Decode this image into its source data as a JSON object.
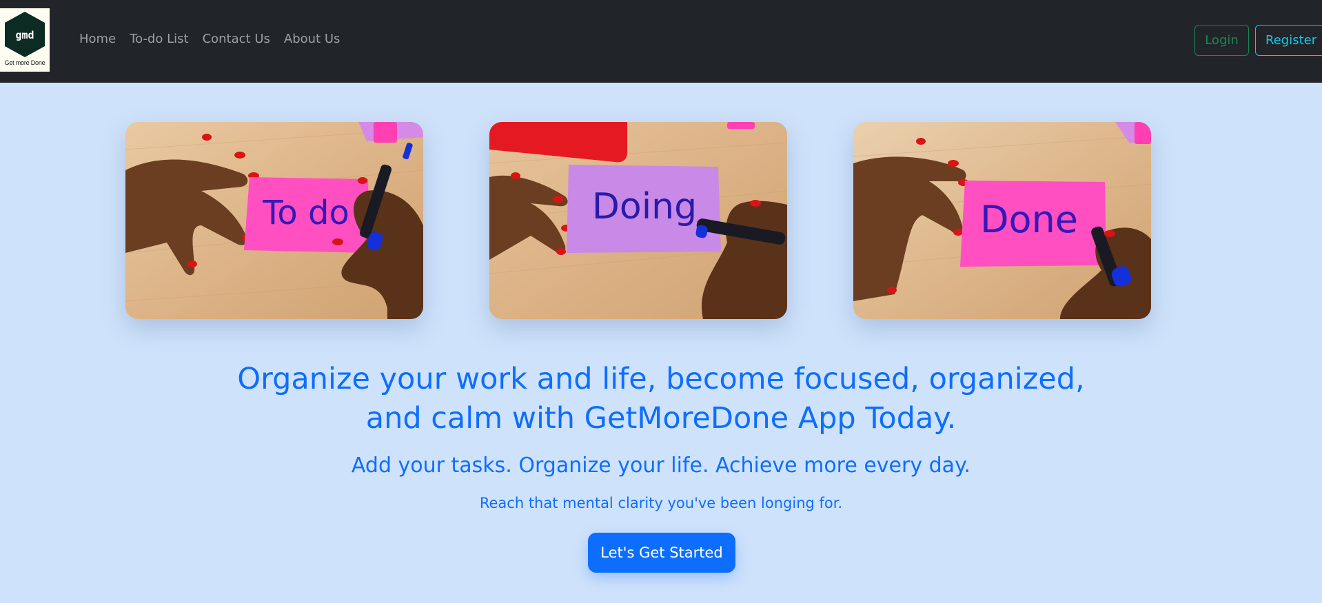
{
  "navbar": {
    "logo_text": "gmd",
    "logo_tagline": "Get more Done",
    "links": [
      {
        "label": "Home"
      },
      {
        "label": "To-do List"
      },
      {
        "label": "Contact Us"
      },
      {
        "label": "About Us"
      }
    ],
    "login_label": "Login",
    "register_label": "Register"
  },
  "cards": [
    {
      "note_text": "To do",
      "note_color": "#ff4fc0"
    },
    {
      "note_text": "Doing",
      "note_color": "#c88ae6"
    },
    {
      "note_text": "Done",
      "note_color": "#ff4fc0"
    }
  ],
  "hero": {
    "title_line1": "Organize your work and life, become focused, organized,",
    "title_line2": "and calm with GetMoreDone App Today.",
    "subtitle": "Add your tasks. Organize your life. Achieve more every day.",
    "description": "Reach that mental clarity you've been longing for.",
    "cta_label": "Let's Get Started"
  },
  "colors": {
    "navbar_bg": "#212529",
    "page_bg": "#cfe2fb",
    "primary": "#0d6efd",
    "login_green": "#198754",
    "register_cyan": "#0dcaf0"
  }
}
